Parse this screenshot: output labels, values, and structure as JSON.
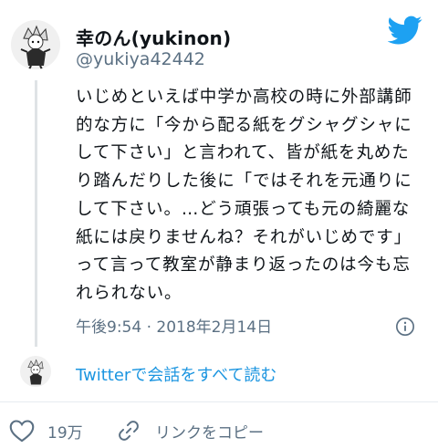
{
  "author": {
    "display_name": "幸のん(yukinon)",
    "handle": "@yukiya42442"
  },
  "tweet": {
    "text": "いじめといえば中学か高校の時に外部講師\n的な方に「今から配る紙をグシャグシャに\nして下さい」と言われて、皆が紙を丸めた\nり踏んだりした後に「ではそれを元通りに\nして下さい。…どう頑張っても元の綺麗な\n紙には戻りませんね？それがいじめです」\nって言って教室が静まり返ったのは今も忘\nれられない。",
    "timestamp": "午後9:54 · 2018年2月14日"
  },
  "conversation": {
    "label": "Twitterで会話をすべて読む"
  },
  "actions": {
    "like_count": "19万",
    "copy_link_label": "リンクをコピー"
  },
  "icons": {
    "logo": "twitter-bird-icon",
    "info": "info-icon",
    "like": "heart-icon",
    "link": "link-icon"
  },
  "colors": {
    "twitter_blue": "#1da1f2",
    "link_blue": "#1b95e0",
    "secondary_text": "#5b7083",
    "thread_line": "#dfe3e6"
  }
}
